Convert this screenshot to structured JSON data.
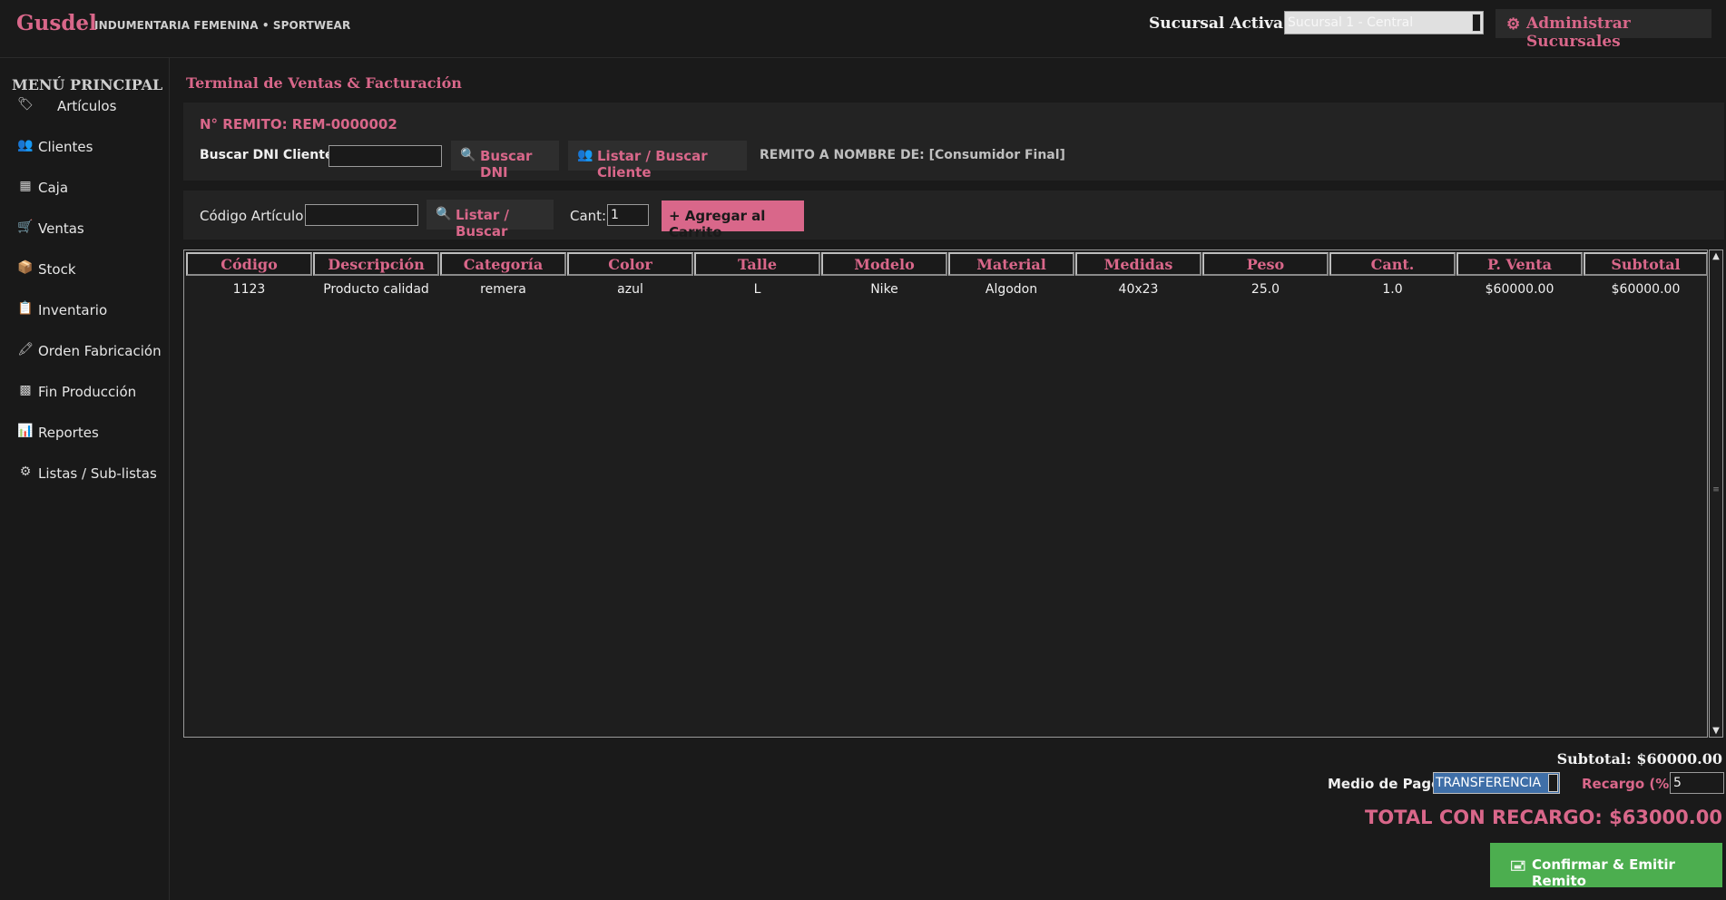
{
  "header": {
    "brand": "Gusdel",
    "tagline": "INDUMENTARIA FEMENINA • SPORTWEAR",
    "branch_label": "Sucursal Activa:",
    "branch_value": "Sucursal 1 - Central",
    "admin_button": "Administrar Sucursales",
    "admin_icon": "gear-icon"
  },
  "sidebar": {
    "title": "MENÚ PRINCIPAL",
    "items": [
      {
        "label": "Artículos",
        "icon": "tag-icon"
      },
      {
        "label": "Clientes",
        "icon": "users-icon"
      },
      {
        "label": "Caja",
        "icon": "cash-register-icon"
      },
      {
        "label": "Ventas",
        "icon": "cart-icon"
      },
      {
        "label": "Stock",
        "icon": "box-icon"
      },
      {
        "label": "Inventario",
        "icon": "clipboard-icon"
      },
      {
        "label": "Orden Fabricación",
        "icon": "syringe-icon"
      },
      {
        "label": "Fin Producción",
        "icon": "checkered-flag-icon"
      },
      {
        "label": "Reportes",
        "icon": "bar-chart-icon"
      },
      {
        "label": "Listas / Sub-listas",
        "icon": "gear-icon"
      }
    ]
  },
  "main": {
    "title": "Terminal de Ventas & Facturación",
    "remito_number": "N° REMITO: REM-0000002",
    "dni_label": "Buscar DNI Cliente:",
    "dni_value": "",
    "buscar_dni_button": "Buscar DNI",
    "listar_cliente_button": "Listar / Buscar Cliente",
    "remito_to": "REMITO A NOMBRE DE: [Consumidor Final]",
    "articulo_label": "Código Artículo:",
    "articulo_value": "",
    "listar_buscar_button": "Listar / Buscar",
    "cant_label": "Cant:",
    "cant_value": "1",
    "agregar_button": "+ Agregar al Carrito"
  },
  "table": {
    "columns": [
      "Código",
      "Descripción",
      "Categoría",
      "Color",
      "Talle",
      "Modelo",
      "Material",
      "Medidas",
      "Peso",
      "Cant.",
      "P. Venta",
      "Subtotal"
    ],
    "rows": [
      [
        "1123",
        "Producto calidad",
        "remera",
        "azul",
        "L",
        "Nike",
        "Algodon",
        "40x23",
        "25.0",
        "1.0",
        "$60000.00",
        "$60000.00"
      ]
    ]
  },
  "footer": {
    "subtotal": "Subtotal: $60000.00",
    "pay_label": "Medio de Pago:",
    "pay_value": "TRANSFERENCIA",
    "recargo_label": "Recargo (%):",
    "recargo_value": "5",
    "total": "TOTAL CON RECARGO: $63000.00",
    "confirm_button": "Confirmar & Emitir Remito"
  },
  "colors": {
    "accent": "#d9678a",
    "background": "#1a1a1a",
    "panel": "#232323",
    "confirm": "#4cae4f"
  }
}
